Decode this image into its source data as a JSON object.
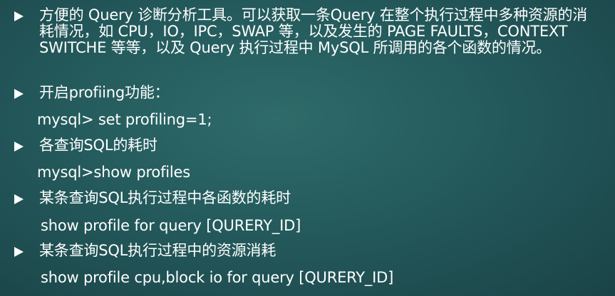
{
  "slide": {
    "items": [
      {
        "type": "bullet",
        "text": "方便的 Query 诊断分析工具。可以获取一条Query 在整个执行过程中多种资源的消耗情况，如 CPU，IO，IPC，SWAP 等，以及发生的 PAGE FAULTS，CONTEXT SWITCHE 等等，以及 Query 执行过程中 MySQL 所调用的各个函数的情况。"
      },
      {
        "type": "bullet",
        "text": "开启profiing功能："
      },
      {
        "type": "code",
        "text": "mysql> set profiling=1;"
      },
      {
        "type": "bullet",
        "text": "各查询SQL的耗时"
      },
      {
        "type": "code",
        "text": "mysql>show profiles"
      },
      {
        "type": "bullet",
        "text": "某条查询SQL执行过程中各函数的耗时"
      },
      {
        "type": "code",
        "text": "show profile for query [QURERY_ID]"
      },
      {
        "type": "bullet",
        "text": "某条查询SQL执行过程中的资源消耗"
      },
      {
        "type": "code",
        "text": "show profile cpu,block io for query [QURERY_ID]"
      }
    ]
  },
  "colors": {
    "background": "#245a5c",
    "text": "#ffffff"
  }
}
